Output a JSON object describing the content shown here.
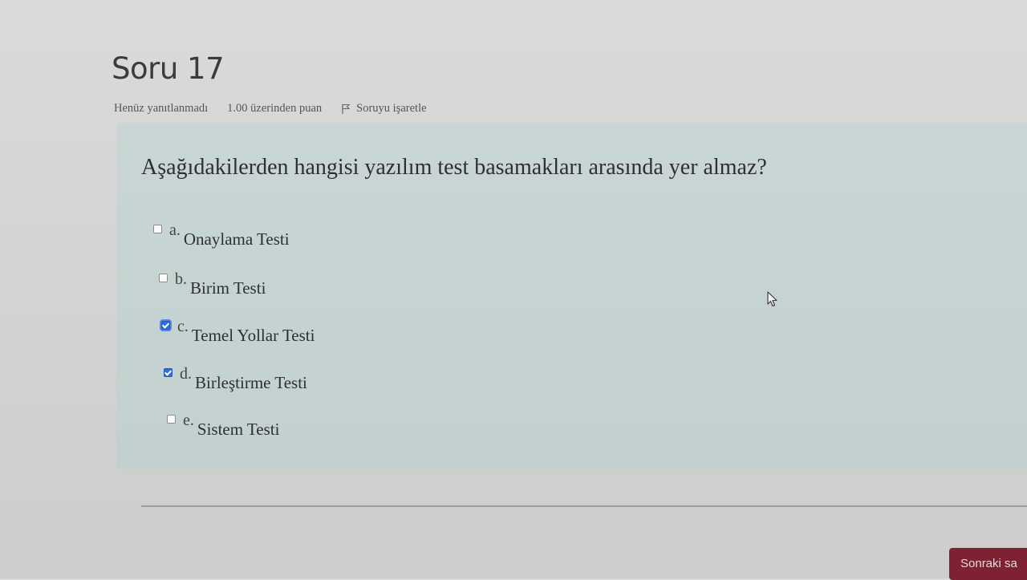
{
  "question": {
    "title": "Soru 17",
    "state": "Henüz yanıtlanmadı",
    "grade": "1.00 üzerinden puan",
    "flag_label": "Soruyu işaretle",
    "text": "Aşağıdakilerden hangisi yazılım test basamakları arasında yer almaz?",
    "answers": [
      {
        "letter": "a.",
        "text": "Onaylama Testi",
        "checked": false
      },
      {
        "letter": "b.",
        "text": "Birim Testi",
        "checked": false
      },
      {
        "letter": "c.",
        "text": "Temel Yollar Testi",
        "checked": true
      },
      {
        "letter": "d.",
        "text": "Birleştirme Testi",
        "checked": true
      },
      {
        "letter": "e.",
        "text": "Sistem Testi",
        "checked": false
      }
    ]
  },
  "navigation": {
    "next_label": "Sonraki sa"
  },
  "icons": {
    "flag": "flag-icon",
    "cursor": "mouse-pointer-icon"
  },
  "colors": {
    "question_bg": "#c5d3d2",
    "checkbox_checked": "#2f6de0",
    "next_button": "#7d2133"
  }
}
